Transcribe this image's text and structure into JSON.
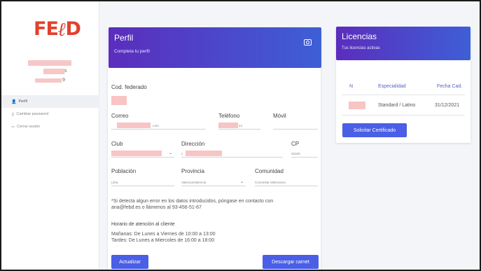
{
  "sidebar": {
    "logo_text": "FE",
    "logo_mark": "ℓ",
    "logo_end": "D",
    "user_name_tail": "s",
    "user_id_tail": "9",
    "items": [
      {
        "icon": "user-icon",
        "glyph": "👤",
        "label": "Perfil",
        "active": true
      },
      {
        "icon": "key-icon",
        "glyph": "⚷",
        "label": "Cambiar password",
        "active": false
      },
      {
        "icon": "logout-icon",
        "glyph": "⇦",
        "label": "Cerrar sesión",
        "active": false
      }
    ]
  },
  "profile": {
    "title": "Perfil",
    "subtitle": "Completa tu perfil",
    "camera_icon": "camera-icon",
    "fields": {
      "cod_federado": {
        "label": "Cod. federado"
      },
      "correo": {
        "label": "Correo",
        "value_tail": ".com"
      },
      "telefono": {
        "label": "Teléfono",
        "value_tail": "24"
      },
      "movil": {
        "label": "Móvil"
      },
      "club": {
        "label": "Club"
      },
      "direccion": {
        "label": "Dirección",
        "value_head": "c"
      },
      "cp": {
        "label": "CP",
        "value": "46160"
      },
      "poblacion": {
        "label": "Población",
        "value": "Lliria"
      },
      "provincia": {
        "label": "Provincia",
        "value": "Valencia/Valencia"
      },
      "comunidad": {
        "label": "Comunidad",
        "value": "Comunitat Valenciana"
      }
    },
    "note_line1": "*Si detecta algun error en los datos introducidos, póngase en contacto con",
    "note_line2": "ana@febd.es o llámenos al 93-456-51-67",
    "hours_title": "Horario de atención al cliente",
    "hours_line1": "Mañanas: De Lunes a Viernes de 10:00 a 13:00",
    "hours_line2": "Tardes: De Lunes a Miercoles de 16:00 a 18:00",
    "update_button": "Actualizar",
    "download_button": "Descargar carnet"
  },
  "licencias": {
    "title": "Licencias",
    "subtitle": "Tus licencias activas",
    "columns": [
      "N",
      "Especialidad",
      "Fecha Cad."
    ],
    "rows": [
      {
        "n": "",
        "especialidad": "Standard / Latino",
        "fecha": "31/12/2021"
      }
    ],
    "request_button": "Solicitar Certificado"
  },
  "colors": {
    "accent": "#4a5ee6",
    "header_start": "#5b2dbd",
    "header_end": "#3e5fd6",
    "logo": "#e2412e",
    "redaction": "#f8c4c4"
  }
}
